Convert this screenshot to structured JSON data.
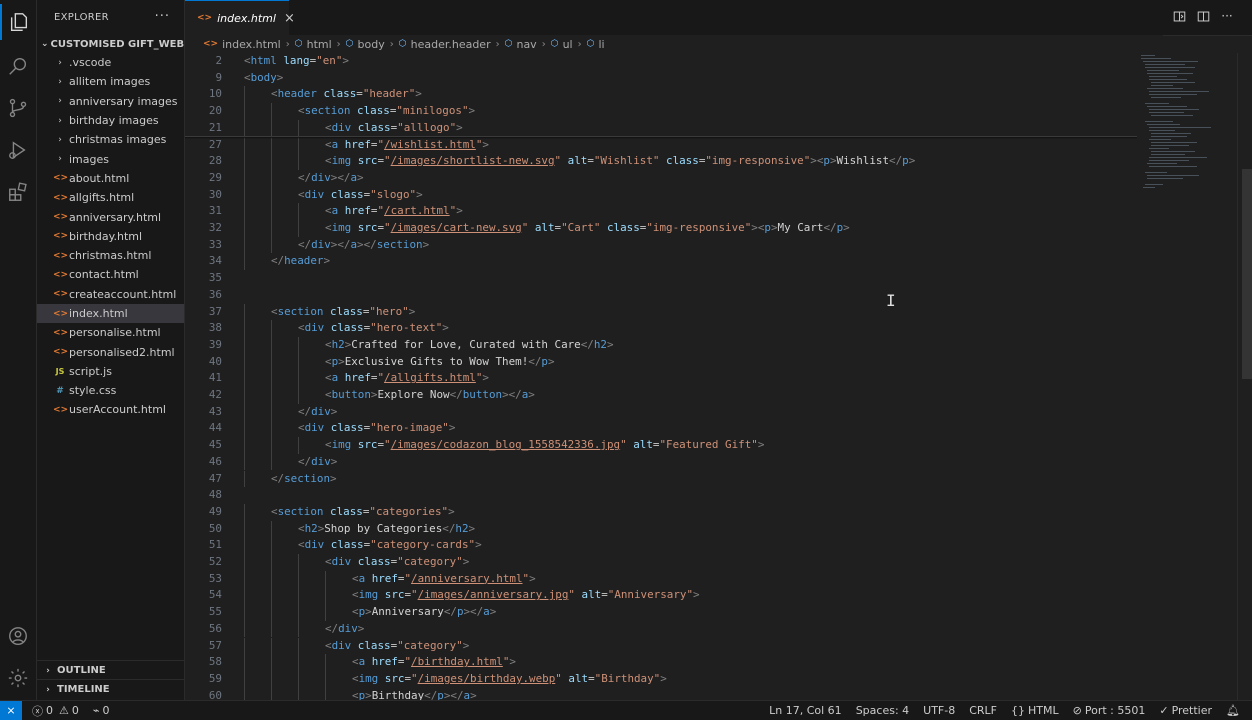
{
  "sidebar": {
    "title": "EXPLORER",
    "more": "···",
    "root": "CUSTOMISED GIFT_WEBSITE",
    "folders": [
      ".vscode",
      "allitem images",
      "anniversary images",
      "birthday images",
      "christmas images",
      "images"
    ],
    "files": [
      {
        "name": "about.html",
        "type": "html"
      },
      {
        "name": "allgifts.html",
        "type": "html"
      },
      {
        "name": "anniversary.html",
        "type": "html"
      },
      {
        "name": "birthday.html",
        "type": "html"
      },
      {
        "name": "christmas.html",
        "type": "html"
      },
      {
        "name": "contact.html",
        "type": "html"
      },
      {
        "name": "createaccount.html",
        "type": "html"
      },
      {
        "name": "index.html",
        "type": "html",
        "selected": true
      },
      {
        "name": "personalise.html",
        "type": "html"
      },
      {
        "name": "personalised2.html",
        "type": "html"
      },
      {
        "name": "script.js",
        "type": "js"
      },
      {
        "name": "style.css",
        "type": "css"
      },
      {
        "name": "userAccount.html",
        "type": "html"
      }
    ],
    "outline": "OUTLINE",
    "timeline": "TIMELINE"
  },
  "tab": {
    "name": "index.html",
    "close": "×"
  },
  "breadcrumbs": [
    "index.html",
    "html",
    "body",
    "header.header",
    "nav",
    "ul",
    "li"
  ],
  "editor": {
    "lines": [
      {
        "n": "2",
        "i": 0,
        "h": "<span class='t-br'>&lt;</span><span class='t-tag'>html</span> <span class='t-attr'>lang</span><span class='t-eq'>=</span><span class='t-str'>\"en\"</span><span class='t-br'>&gt;</span>"
      },
      {
        "n": "9",
        "i": 0,
        "h": "<span class='t-br'>&lt;</span><span class='t-tag'>body</span><span class='t-br'>&gt;</span>"
      },
      {
        "n": "10",
        "i": 1,
        "h": "<span class='t-br'>&lt;</span><span class='t-tag'>header</span> <span class='t-attr'>class</span><span class='t-eq'>=</span><span class='t-str'>\"header\"</span><span class='t-br'>&gt;</span>"
      },
      {
        "n": "20",
        "i": 2,
        "h": "<span class='t-br'>&lt;</span><span class='t-tag'>section</span> <span class='t-attr'>class</span><span class='t-eq'>=</span><span class='t-str'>\"minilogos\"</span><span class='t-br'>&gt;</span>"
      },
      {
        "n": "21",
        "i": 3,
        "h": "<span class='t-br'>&lt;</span><span class='t-tag'>div</span> <span class='t-attr'>class</span><span class='t-eq'>=</span><span class='t-str'>\"alllogo\"</span><span class='t-br'>&gt;</span>"
      },
      {
        "n": "27",
        "i": 3,
        "h": "<span class='t-br'>&lt;</span><span class='t-tag'>a</span> <span class='t-attr'>href</span><span class='t-eq'>=</span><span class='t-str'>\"</span><span class='t-link'>/wishlist.html</span><span class='t-str'>\"</span><span class='t-br'>&gt;</span>"
      },
      {
        "n": "28",
        "i": 3,
        "h": "<span class='t-br'>&lt;</span><span class='t-tag'>img</span> <span class='t-attr'>src</span><span class='t-eq'>=</span><span class='t-str'>\"</span><span class='t-link'>/images/shortlist-new.svg</span><span class='t-str'>\"</span> <span class='t-attr'>alt</span><span class='t-eq'>=</span><span class='t-str'>\"Wishlist\"</span> <span class='t-attr'>class</span><span class='t-eq'>=</span><span class='t-str'>\"img-responsive\"</span><span class='t-br'>&gt;&lt;</span><span class='t-tag'>p</span><span class='t-br'>&gt;</span><span class='t-text'>Wishlist</span><span class='t-br'>&lt;/</span><span class='t-tag'>p</span><span class='t-br'>&gt;</span>"
      },
      {
        "n": "29",
        "i": 2,
        "h": "<span class='t-br'>&lt;/</span><span class='t-tag'>div</span><span class='t-br'>&gt;&lt;/</span><span class='t-tag'>a</span><span class='t-br'>&gt;</span>"
      },
      {
        "n": "30",
        "i": 2,
        "h": "<span class='t-br'>&lt;</span><span class='t-tag'>div</span> <span class='t-attr'>class</span><span class='t-eq'>=</span><span class='t-str'>\"slogo\"</span><span class='t-br'>&gt;</span>"
      },
      {
        "n": "31",
        "i": 3,
        "h": "<span class='t-br'>&lt;</span><span class='t-tag'>a</span> <span class='t-attr'>href</span><span class='t-eq'>=</span><span class='t-str'>\"</span><span class='t-link'>/cart.html</span><span class='t-str'>\"</span><span class='t-br'>&gt;</span>"
      },
      {
        "n": "32",
        "i": 3,
        "h": "<span class='t-br'>&lt;</span><span class='t-tag'>img</span> <span class='t-attr'>src</span><span class='t-eq'>=</span><span class='t-str'>\"</span><span class='t-link'>/images/cart-new.svg</span><span class='t-str'>\"</span> <span class='t-attr'>alt</span><span class='t-eq'>=</span><span class='t-str'>\"Cart\"</span> <span class='t-attr'>class</span><span class='t-eq'>=</span><span class='t-str'>\"img-responsive\"</span><span class='t-br'>&gt;&lt;</span><span class='t-tag'>p</span><span class='t-br'>&gt;</span><span class='t-text'>My Cart</span><span class='t-br'>&lt;/</span><span class='t-tag'>p</span><span class='t-br'>&gt;</span>"
      },
      {
        "n": "33",
        "i": 2,
        "h": "<span class='t-br'>&lt;/</span><span class='t-tag'>div</span><span class='t-br'>&gt;&lt;/</span><span class='t-tag'>a</span><span class='t-br'>&gt;&lt;/</span><span class='t-tag'>section</span><span class='t-br'>&gt;</span>"
      },
      {
        "n": "34",
        "i": 1,
        "h": "<span class='t-br'>&lt;/</span><span class='t-tag'>header</span><span class='t-br'>&gt;</span>"
      },
      {
        "n": "35",
        "i": 0,
        "h": ""
      },
      {
        "n": "36",
        "i": 0,
        "h": ""
      },
      {
        "n": "37",
        "i": 1,
        "h": "<span class='t-br'>&lt;</span><span class='t-tag'>section</span> <span class='t-attr'>class</span><span class='t-eq'>=</span><span class='t-str'>\"hero\"</span><span class='t-br'>&gt;</span>"
      },
      {
        "n": "38",
        "i": 2,
        "h": "<span class='t-br'>&lt;</span><span class='t-tag'>div</span> <span class='t-attr'>class</span><span class='t-eq'>=</span><span class='t-str'>\"hero-text\"</span><span class='t-br'>&gt;</span>"
      },
      {
        "n": "39",
        "i": 3,
        "h": "<span class='t-br'>&lt;</span><span class='t-tag'>h2</span><span class='t-br'>&gt;</span><span class='t-text'>Crafted for Love, Curated with Care</span><span class='t-br'>&lt;/</span><span class='t-tag'>h2</span><span class='t-br'>&gt;</span>"
      },
      {
        "n": "40",
        "i": 3,
        "h": "<span class='t-br'>&lt;</span><span class='t-tag'>p</span><span class='t-br'>&gt;</span><span class='t-text'>Exclusive Gifts to Wow Them!</span><span class='t-br'>&lt;/</span><span class='t-tag'>p</span><span class='t-br'>&gt;</span>"
      },
      {
        "n": "41",
        "i": 3,
        "h": "<span class='t-br'>&lt;</span><span class='t-tag'>a</span> <span class='t-attr'>href</span><span class='t-eq'>=</span><span class='t-str'>\"</span><span class='t-link'>/allgifts.html</span><span class='t-str'>\"</span><span class='t-br'>&gt;</span>"
      },
      {
        "n": "42",
        "i": 3,
        "h": "<span class='t-br'>&lt;</span><span class='t-tag'>button</span><span class='t-br'>&gt;</span><span class='t-text'>Explore Now</span><span class='t-br'>&lt;/</span><span class='t-tag'>button</span><span class='t-br'>&gt;&lt;/</span><span class='t-tag'>a</span><span class='t-br'>&gt;</span>"
      },
      {
        "n": "43",
        "i": 2,
        "h": "<span class='t-br'>&lt;/</span><span class='t-tag'>div</span><span class='t-br'>&gt;</span>"
      },
      {
        "n": "44",
        "i": 2,
        "h": "<span class='t-br'>&lt;</span><span class='t-tag'>div</span> <span class='t-attr'>class</span><span class='t-eq'>=</span><span class='t-str'>\"hero-image\"</span><span class='t-br'>&gt;</span>"
      },
      {
        "n": "45",
        "i": 3,
        "h": "<span class='t-br'>&lt;</span><span class='t-tag'>img</span> <span class='t-attr'>src</span><span class='t-eq'>=</span><span class='t-str'>\"</span><span class='t-link'>/images/codazon_blog_1558542336.jpg</span><span class='t-str'>\"</span> <span class='t-attr'>alt</span><span class='t-eq'>=</span><span class='t-str'>\"Featured Gift\"</span><span class='t-br'>&gt;</span>"
      },
      {
        "n": "46",
        "i": 2,
        "h": "<span class='t-br'>&lt;/</span><span class='t-tag'>div</span><span class='t-br'>&gt;</span>"
      },
      {
        "n": "47",
        "i": 1,
        "h": "<span class='t-br'>&lt;/</span><span class='t-tag'>section</span><span class='t-br'>&gt;</span>"
      },
      {
        "n": "48",
        "i": 0,
        "h": ""
      },
      {
        "n": "49",
        "i": 1,
        "h": "<span class='t-br'>&lt;</span><span class='t-tag'>section</span> <span class='t-attr'>class</span><span class='t-eq'>=</span><span class='t-str'>\"categories\"</span><span class='t-br'>&gt;</span>"
      },
      {
        "n": "50",
        "i": 2,
        "h": "<span class='t-br'>&lt;</span><span class='t-tag'>h2</span><span class='t-br'>&gt;</span><span class='t-text'>Shop by Categories</span><span class='t-br'>&lt;/</span><span class='t-tag'>h2</span><span class='t-br'>&gt;</span>"
      },
      {
        "n": "51",
        "i": 2,
        "h": "<span class='t-br'>&lt;</span><span class='t-tag'>div</span> <span class='t-attr'>class</span><span class='t-eq'>=</span><span class='t-str'>\"category-cards\"</span><span class='t-br'>&gt;</span>"
      },
      {
        "n": "52",
        "i": 3,
        "h": "<span class='t-br'>&lt;</span><span class='t-tag'>div</span> <span class='t-attr'>class</span><span class='t-eq'>=</span><span class='t-str'>\"category\"</span><span class='t-br'>&gt;</span>"
      },
      {
        "n": "53",
        "i": 4,
        "h": "<span class='t-br'>&lt;</span><span class='t-tag'>a</span> <span class='t-attr'>href</span><span class='t-eq'>=</span><span class='t-str'>\"</span><span class='t-link'>/anniversary.html</span><span class='t-str'>\"</span><span class='t-br'>&gt;</span>"
      },
      {
        "n": "54",
        "i": 4,
        "h": "<span class='t-br'>&lt;</span><span class='t-tag'>img</span> <span class='t-attr'>src</span><span class='t-eq'>=</span><span class='t-str'>\"</span><span class='t-link'>/images/anniversary.jpg</span><span class='t-str'>\"</span> <span class='t-attr'>alt</span><span class='t-eq'>=</span><span class='t-str'>\"Anniversary\"</span><span class='t-br'>&gt;</span>"
      },
      {
        "n": "55",
        "i": 4,
        "h": "<span class='t-br'>&lt;</span><span class='t-tag'>p</span><span class='t-br'>&gt;</span><span class='t-text'>Anniversary</span><span class='t-br'>&lt;/</span><span class='t-tag'>p</span><span class='t-br'>&gt;&lt;/</span><span class='t-tag'>a</span><span class='t-br'>&gt;</span>"
      },
      {
        "n": "56",
        "i": 3,
        "h": "<span class='t-br'>&lt;/</span><span class='t-tag'>div</span><span class='t-br'>&gt;</span>"
      },
      {
        "n": "57",
        "i": 3,
        "h": "<span class='t-br'>&lt;</span><span class='t-tag'>div</span> <span class='t-attr'>class</span><span class='t-eq'>=</span><span class='t-str'>\"category\"</span><span class='t-br'>&gt;</span>"
      },
      {
        "n": "58",
        "i": 4,
        "h": "<span class='t-br'>&lt;</span><span class='t-tag'>a</span> <span class='t-attr'>href</span><span class='t-eq'>=</span><span class='t-str'>\"</span><span class='t-link'>/birthday.html</span><span class='t-str'>\"</span><span class='t-br'>&gt;</span>"
      },
      {
        "n": "59",
        "i": 4,
        "h": "<span class='t-br'>&lt;</span><span class='t-tag'>img</span> <span class='t-attr'>src</span><span class='t-eq'>=</span><span class='t-str'>\"</span><span class='t-link'>/images/birthday.webp</span><span class='t-str'>\"</span> <span class='t-attr'>alt</span><span class='t-eq'>=</span><span class='t-str'>\"Birthday\"</span><span class='t-br'>&gt;</span>"
      },
      {
        "n": "60",
        "i": 4,
        "h": "<span class='t-br'>&lt;</span><span class='t-tag'>p</span><span class='t-br'>&gt;</span><span class='t-text'>Birthday</span><span class='t-br'>&lt;/</span><span class='t-tag'>p</span><span class='t-br'>&gt;&lt;/</span><span class='t-tag'>a</span><span class='t-br'>&gt;</span>"
      }
    ]
  },
  "status": {
    "errors": "0",
    "warnings": "0",
    "ports": "0",
    "position": "Ln 17, Col 61",
    "spaces": "Spaces: 4",
    "encoding": "UTF-8",
    "eol": "CRLF",
    "language": "HTML",
    "port": "Port : 5501",
    "formatter": "Prettier"
  },
  "colors": {
    "accent": "#0078d4",
    "html_icon": "#e37933",
    "js_icon": "#cbcb41",
    "css_icon": "#519aba"
  }
}
